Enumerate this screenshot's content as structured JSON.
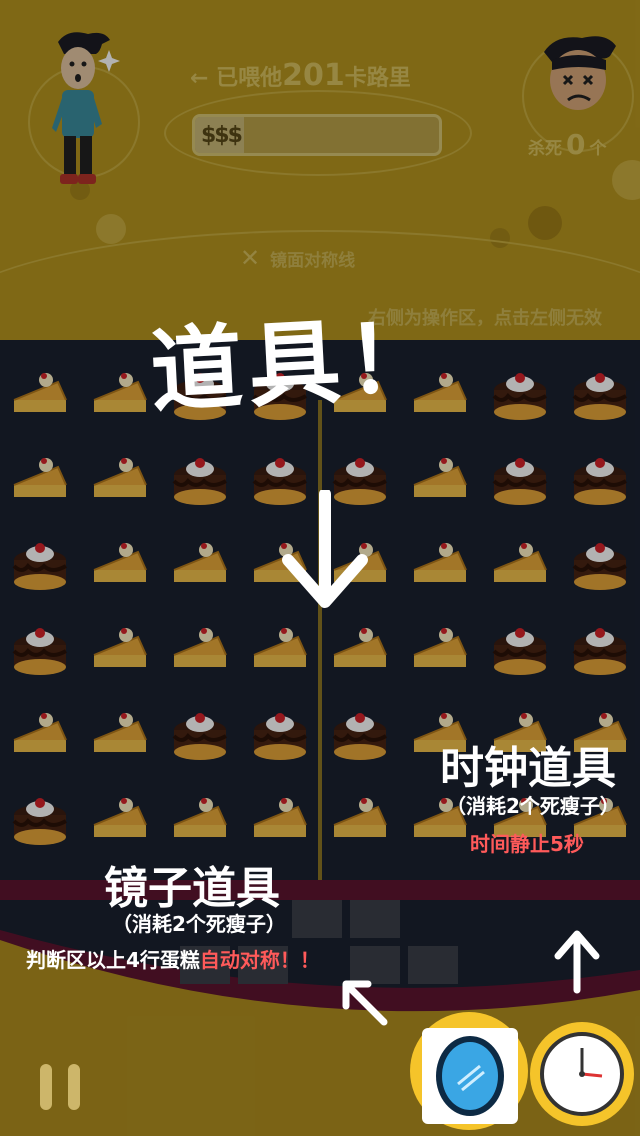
{
  "header": {
    "fed_prefix": "← 已喂他",
    "fed_value": "201",
    "fed_suffix": "卡路里",
    "progress_fraction": 0.2,
    "kill_prefix": "杀死",
    "kill_value": "0",
    "kill_suffix": "个"
  },
  "board_hints": {
    "mirror_line": "镜面对称线",
    "operation_hint": "右侧为操作区，点击左侧无效"
  },
  "tutorial": {
    "title": "道具！",
    "clock_label": "时钟道具",
    "clock_cost": "（消耗2个死瘦子）",
    "clock_effect": "时间静止5秒",
    "mirror_label": "镜子道具",
    "mirror_cost": "（消耗2个死瘦子）",
    "mirror_effect_normal": "判断区以上4行蛋糕",
    "mirror_effect_highlight": "自动对称！！"
  },
  "colors": {
    "background": "#b7961f",
    "board": "#1a2130",
    "highlight_red": "#ff5a5a",
    "tool_ring": "#f5c42a"
  },
  "icons": [
    "pause-icon",
    "mirror-tool-icon",
    "clock-tool-icon",
    "arrow-down-icon",
    "arrow-up-icon",
    "arrow-diagonal-icon"
  ],
  "grid_layout": [
    [
      "pie",
      "pie",
      "choc",
      "choc",
      "pie",
      "pie",
      "choc",
      "choc"
    ],
    [
      "pie",
      "pie",
      "choc",
      "choc",
      "choc",
      "pie",
      "choc",
      "choc"
    ],
    [
      "choc",
      "pie",
      "pie",
      "pie",
      "pie",
      "pie",
      "pie",
      "choc"
    ],
    [
      "choc",
      "pie",
      "pie",
      "pie",
      "pie",
      "pie",
      "choc",
      "choc"
    ],
    [
      "pie",
      "pie",
      "choc",
      "choc",
      "choc",
      "pie",
      "pie",
      "pie"
    ],
    [
      "choc",
      "pie",
      "pie",
      "pie",
      "pie",
      "pie",
      "pie",
      "pie"
    ]
  ]
}
